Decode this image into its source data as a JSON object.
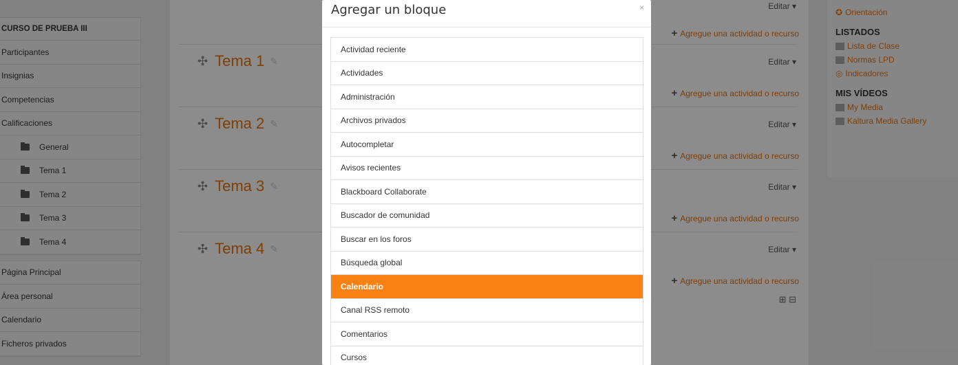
{
  "left_nav": {
    "course_block": [
      {
        "label": "CURSO DE PRUEBA III",
        "kind": "head"
      },
      {
        "label": "Participantes",
        "kind": "item"
      },
      {
        "label": "Insignias",
        "kind": "item"
      },
      {
        "label": "Competencias",
        "kind": "item"
      },
      {
        "label": "Calificaciones",
        "kind": "item"
      },
      {
        "label": "General",
        "kind": "sub"
      },
      {
        "label": "Tema 1",
        "kind": "sub"
      },
      {
        "label": "Tema 2",
        "kind": "sub"
      },
      {
        "label": "Tema 3",
        "kind": "sub"
      },
      {
        "label": "Tema 4",
        "kind": "sub"
      }
    ],
    "site_block": [
      {
        "label": "Página Principal"
      },
      {
        "label": "Área personal"
      },
      {
        "label": "Calendario"
      },
      {
        "label": "Ficheros privados"
      }
    ]
  },
  "course": {
    "topics": [
      "Tema 1",
      "Tema 2",
      "Tema 3",
      "Tema 4"
    ],
    "editar_label": "Editar",
    "add_activity_label": "Agregue una actividad o recurso",
    "top_editar": "Editar"
  },
  "right_block": {
    "top_link": "Orientación",
    "listados_title": "LISTADOS",
    "listados_links": [
      "Lista de Clase",
      "Normas LPD",
      "Indicadores"
    ],
    "videos_title": "MIS VÍDEOS",
    "videos_links": [
      "My Media",
      "Kaltura Media Gallery"
    ]
  },
  "modal": {
    "title": "Agregar un bloque",
    "close_label": "×",
    "items": [
      "Actividad reciente",
      "Actividades",
      "Administración",
      "Archivos privados",
      "Autocompletar",
      "Avisos recientes",
      "Blackboard Collaborate",
      "Buscador de comunidad",
      "Buscar en los foros",
      "Búsqueda global",
      "Calendario",
      "Canal RSS remoto",
      "Comentarios",
      "Cursos"
    ],
    "active_item": "Calendario",
    "accent_color": "#f98012"
  }
}
